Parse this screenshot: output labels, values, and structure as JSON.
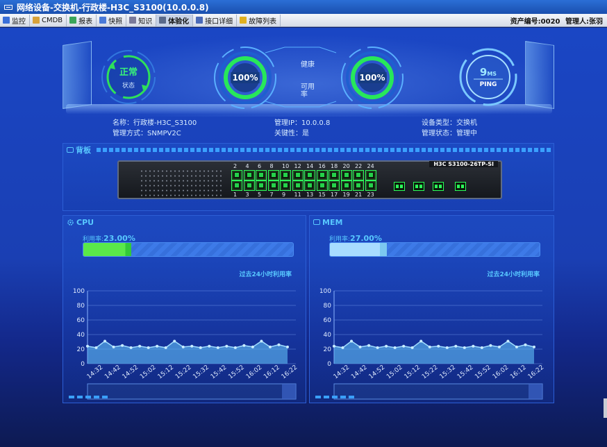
{
  "window": {
    "title": "网络设备-交换机-行政楼-H3C_S3100(10.0.0.8)"
  },
  "toolbar": {
    "items": [
      {
        "label": "监控",
        "icon": "monitor-icon",
        "color": "#3a6fd8"
      },
      {
        "label": "CMDB",
        "icon": "cmdb-icon",
        "color": "#d8a23a"
      },
      {
        "label": "报表",
        "icon": "report-icon",
        "color": "#3aa55a"
      },
      {
        "label": "快照",
        "icon": "snapshot-icon",
        "color": "#4a7ad8"
      },
      {
        "label": "知识",
        "icon": "knowledge-icon",
        "color": "#7a7a9a"
      },
      {
        "label": "体验化",
        "icon": "experience-icon",
        "color": "#5a6a8a"
      },
      {
        "label": "接口详细",
        "icon": "interface-icon",
        "color": "#4a6ab8"
      },
      {
        "label": "故障列表",
        "icon": "warning-icon",
        "color": "#e0b020"
      }
    ],
    "active_index": 5,
    "asset_no": "资产编号:0020",
    "manager": "管理人:张羽"
  },
  "hero": {
    "status_main": "正常",
    "status_sub": "状态",
    "health_pct": "100%",
    "health_label": "健康",
    "availability_pct": "100%",
    "availability_label": "可用率",
    "ping_value": "9",
    "ping_unit": "MS",
    "ping_label": "PING"
  },
  "info": {
    "name": "名称：行政楼-H3C_S3100",
    "mgmt_ip": "管理IP：10.0.0.8",
    "device_type": "设备类型：交换机",
    "mgmt_method": "管理方式：SNMPV2C",
    "critical": "关键性：是",
    "mgmt_status": "管理状态：管理中"
  },
  "backplane": {
    "title": "背板",
    "model": "H3C S3100-26TP-SI",
    "top_ports": [
      "2",
      "4",
      "6",
      "8",
      "10",
      "12",
      "14",
      "16",
      "18",
      "20",
      "22",
      "24"
    ],
    "bottom_ports": [
      "1",
      "3",
      "5",
      "7",
      "9",
      "11",
      "13",
      "15",
      "17",
      "19",
      "21",
      "23"
    ]
  },
  "cpu": {
    "title": "CPU",
    "usage_label": "利用率:",
    "usage_value": "23.00%",
    "usage": 23,
    "chart_title": "过去24小时利用率",
    "fill_color": "#5ae84a"
  },
  "mem": {
    "title": "MEM",
    "usage_label": "利用率:",
    "usage_value": "27.00%",
    "usage": 27,
    "chart_title": "过去24小时利用率",
    "fill_color": "#a8dcff"
  },
  "chart_data": [
    {
      "type": "area",
      "name": "CPU",
      "x": [
        "14:32",
        "14:42",
        "14:52",
        "15:02",
        "15:12",
        "15:22",
        "15:32",
        "15:42",
        "15:52",
        "16:02",
        "16:12",
        "16:22"
      ],
      "values": [
        24,
        22,
        31,
        23,
        25,
        22,
        24,
        22,
        24,
        22,
        31,
        23,
        24,
        22,
        24,
        22,
        24,
        22,
        25,
        23,
        31,
        23,
        26,
        23
      ],
      "y_ticks": [
        0,
        20,
        40,
        60,
        80,
        100
      ],
      "ylim": [
        0,
        100
      ]
    },
    {
      "type": "area",
      "name": "MEM",
      "x": [
        "14:32",
        "14:42",
        "14:52",
        "15:02",
        "15:12",
        "15:22",
        "15:32",
        "15:42",
        "15:52",
        "16:02",
        "16:12",
        "16:22"
      ],
      "values": [
        24,
        22,
        31,
        23,
        25,
        22,
        24,
        22,
        24,
        22,
        31,
        23,
        24,
        22,
        24,
        22,
        24,
        22,
        25,
        23,
        31,
        23,
        26,
        23
      ],
      "y_ticks": [
        0,
        20,
        40,
        60,
        80,
        100
      ],
      "ylim": [
        0,
        100
      ]
    }
  ]
}
